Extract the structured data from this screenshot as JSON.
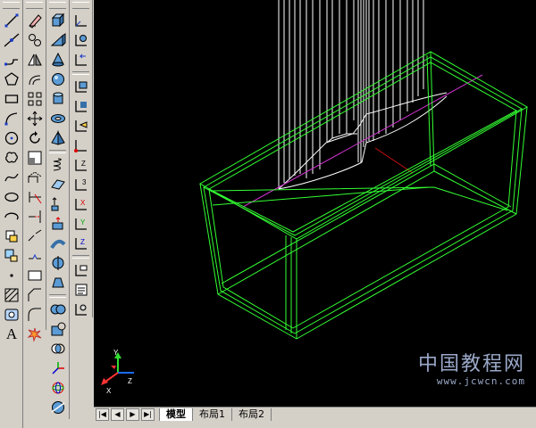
{
  "draw_toolbar": {
    "icons": [
      "line-icon",
      "construction-line-icon",
      "polyline-icon",
      "polygon-icon",
      "rectangle-icon",
      "arc-icon",
      "circle-icon",
      "revision-cloud-icon",
      "spline-icon",
      "ellipse-icon",
      "ellipse-arc-icon",
      "insert-block-icon",
      "make-block-icon",
      "point-icon",
      "hatch-icon",
      "region-icon",
      "multiline-text-icon"
    ],
    "text_tool_label": "A"
  },
  "modify_toolbar": {
    "icons": [
      "erase-icon",
      "copy-icon",
      "mirror-icon",
      "offset-icon",
      "array-icon",
      "move-icon",
      "rotate-icon",
      "scale-icon",
      "stretch-icon",
      "trim-icon",
      "extend-icon",
      "break-at-point-icon",
      "break-icon",
      "join-icon",
      "chamfer-icon",
      "fillet-icon",
      "explode-icon"
    ]
  },
  "modeling_toolbar": {
    "icons": [
      "box-icon",
      "wedge-icon",
      "cone-icon",
      "sphere-icon",
      "cylinder-icon",
      "torus-icon",
      "pyramid-icon",
      "helix-icon",
      "planar-surface-icon",
      "extrude-icon",
      "presspull-icon",
      "sweep-icon",
      "revolve-icon",
      "loft-icon",
      "union-icon",
      "subtract-icon",
      "intersect-icon",
      "3d-move-icon",
      "3d-rotate-icon",
      "slice-icon"
    ]
  },
  "ucs_toolbar": {
    "icons": [
      "ucs-icon",
      "world-ucs-icon",
      "previous-ucs-icon",
      "face-ucs-icon",
      "object-ucs-icon",
      "view-ucs-icon",
      "origin-ucs-icon",
      "z-axis-vector-icon",
      "3-point-ucs-icon",
      "x-rotate-icon",
      "y-rotate-icon",
      "z-rotate-icon",
      "apply-ucs-icon",
      "named-ucs-icon",
      "ucs-settings-icon"
    ]
  },
  "ucs_indicator": {
    "axis_x": "X",
    "axis_y": "Y",
    "axis_z": "Z"
  },
  "layout_tabs": {
    "nav_buttons": [
      "|◀",
      "◀",
      "▶",
      "▶|"
    ],
    "tabs": [
      {
        "label": "模型",
        "active": true
      },
      {
        "label": "布局1",
        "active": false
      },
      {
        "label": "布局2",
        "active": false
      }
    ]
  },
  "watermark": {
    "main": "中国教程网",
    "url": "www.jcwcn.com"
  },
  "colors": {
    "viewport_bg": "#000000",
    "box_wire": "#33ff33",
    "profile_wire": "#ffffff",
    "axis_line": "#cc33cc",
    "centre_line": "#cc1111",
    "chrome": "#d4d0c8"
  }
}
